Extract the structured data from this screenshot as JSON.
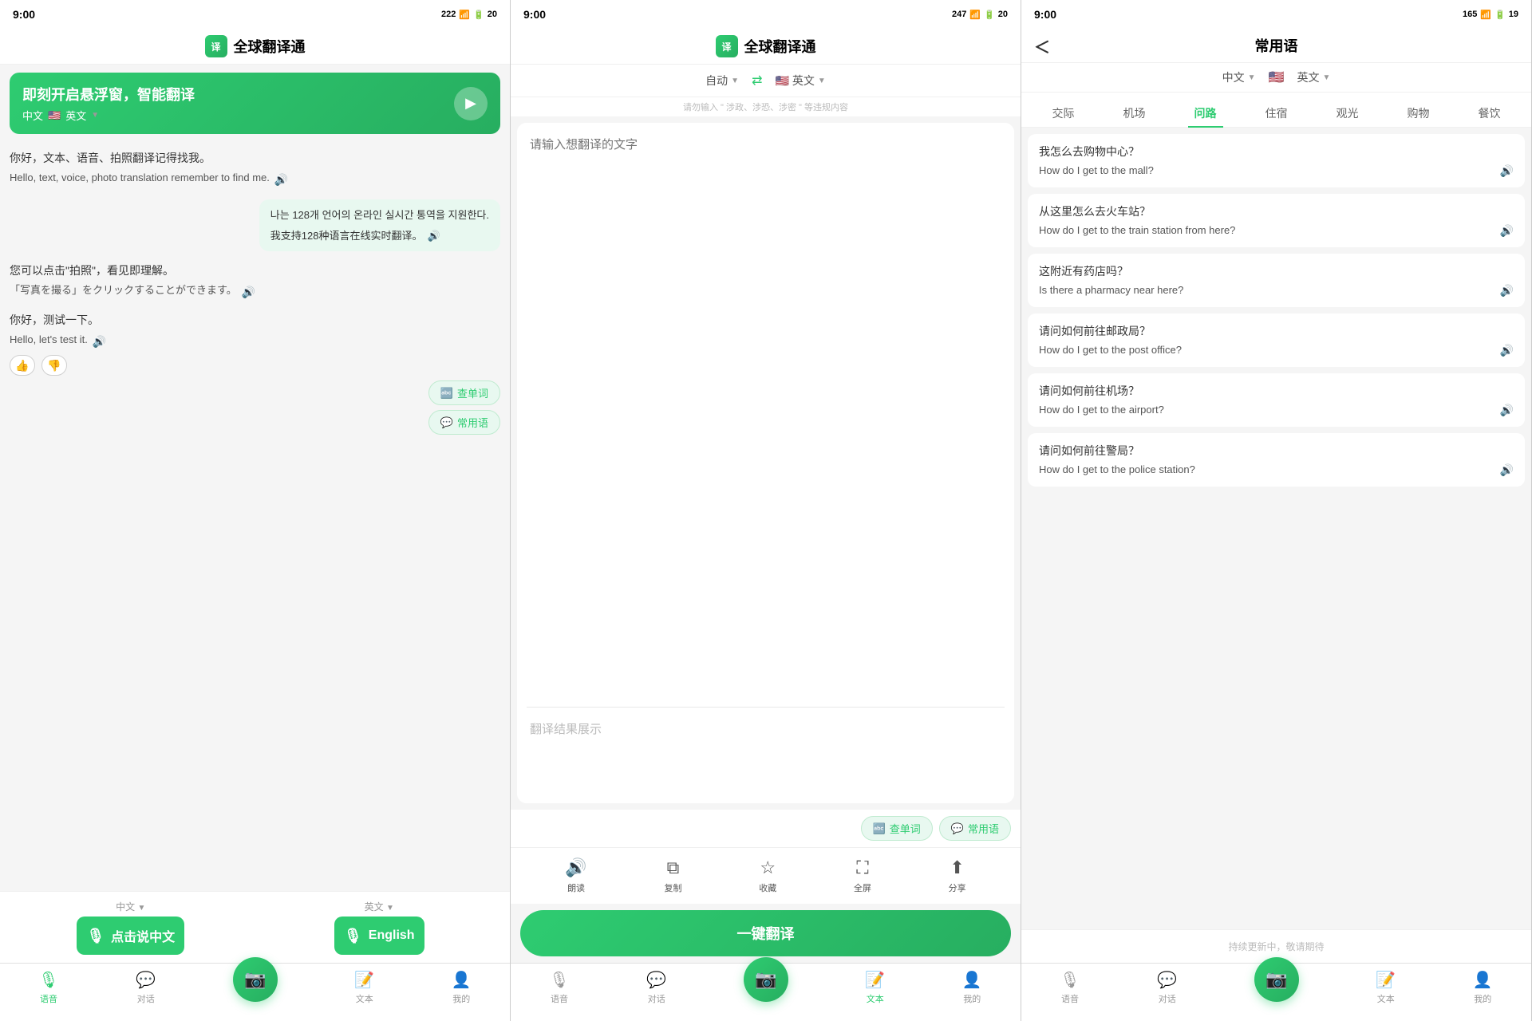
{
  "colors": {
    "green": "#2ecc71",
    "dark_green": "#27ae60",
    "light_green_bg": "#e8f8f0"
  },
  "panel1": {
    "status_time": "9:00",
    "app_title": "全球翻译通",
    "banner": {
      "text": "即刻开启悬浮窗，智能翻译",
      "lang_from": "中文",
      "arrow": "→",
      "lang_to": "英文"
    },
    "chats": [
      {
        "zh": "你好，文本、语音、拍照翻译记得找我。",
        "en": "Hello, text, voice, photo translation remember to find me."
      },
      {
        "ko": "나는 128개 언어의 온라인 실시간 통역을 지원한다.",
        "zh": "我支持128种语言在线实时翻译。"
      },
      {
        "zh": "您可以点击\"拍照\"，看见即理解。",
        "ja": "「写真を撮る」をクリックすることができます。"
      },
      {
        "zh": "你好，测试一下。",
        "en": "Hello, let's test it."
      }
    ],
    "btn_vocab": "查单词",
    "btn_phrase": "常用语",
    "voice_lang_left_label": "中文",
    "voice_lang_right_label": "英文",
    "voice_btn_left": "点击说中文",
    "voice_btn_right": "English"
  },
  "panel2": {
    "status_time": "9:00",
    "app_title": "全球翻译通",
    "lang_from": "自动",
    "lang_to": "英文",
    "warning": "请勿输入 \" 涉政、涉恐、涉密 \" 等违规内容",
    "input_placeholder": "请输入想翻译的文字",
    "result_placeholder": "翻译结果展示",
    "btn_vocab": "查单词",
    "btn_phrase": "常用语",
    "tools": [
      {
        "icon": "🔊",
        "label": "朗读"
      },
      {
        "icon": "⧉",
        "label": "复制"
      },
      {
        "icon": "☆",
        "label": "收藏"
      },
      {
        "icon": "⛶",
        "label": "全屏"
      },
      {
        "icon": "⟨⟩",
        "label": "分享"
      }
    ],
    "translate_btn": "一键翻译"
  },
  "panel3": {
    "status_time": "9:00",
    "back_label": "<",
    "title": "常用语",
    "lang_from": "中文",
    "lang_to": "英文",
    "categories": [
      "交际",
      "机场",
      "问路",
      "住宿",
      "观光",
      "购物",
      "餐饮"
    ],
    "active_category": "问路",
    "phrases": [
      {
        "zh": "我怎么去购物中心？",
        "en": "How do I get to the mall?"
      },
      {
        "zh": "从这里怎么去火车站？",
        "en": "How do I get to the train station from here?"
      },
      {
        "zh": "这附近有药店吗？",
        "en": "Is there a pharmacy near here?"
      },
      {
        "zh": "请问如何前往邮政局？",
        "en": "How do I get to the post office?"
      },
      {
        "zh": "请问如何前往机场？",
        "en": "How do I get to the airport?"
      },
      {
        "zh": "请问如何前往警局？",
        "en": "How do I get to the police station?"
      }
    ],
    "update_notice": "持续更新中，敬请期待"
  },
  "nav": {
    "items": [
      "语音",
      "对话",
      "",
      "文本",
      "我的"
    ]
  }
}
